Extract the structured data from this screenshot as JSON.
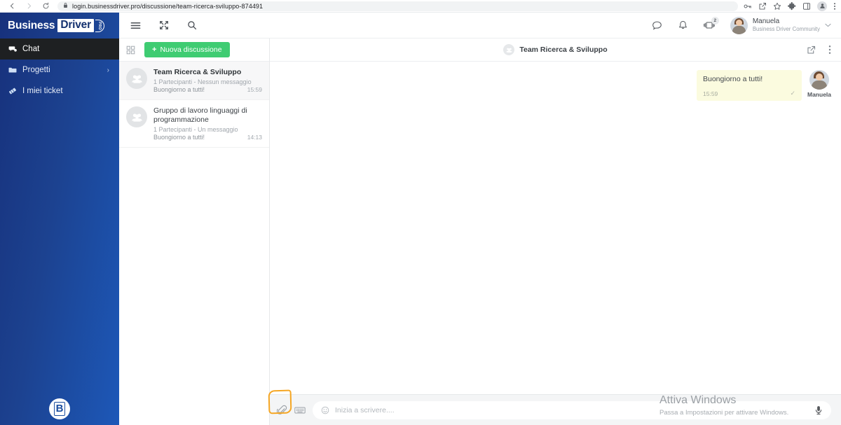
{
  "browser": {
    "back_icon": "back-arrow-icon",
    "forward_icon": "forward-arrow-icon",
    "reload_icon": "reload-icon",
    "lock_icon": "lock-icon",
    "url": "login.businessdriver.pro/discussione/team-ricerca-sviluppo-874491",
    "toolbar_icons": [
      "key-icon",
      "share-icon",
      "star-icon",
      "extensions-puzzle-icon",
      "sidebar-panel-icon",
      "profile-avatar-icon",
      "chrome-menu-icon"
    ]
  },
  "sidebar": {
    "logo": {
      "word1": "Business",
      "word2": "Driver",
      "badge": "PRO"
    },
    "items": [
      {
        "label": "Chat",
        "icon": "chat-bubble-icon",
        "active": true,
        "chevron": ""
      },
      {
        "label": "Progetti",
        "icon": "folder-icon",
        "active": false,
        "chevron": "›"
      },
      {
        "label": "I miei ticket",
        "icon": "ticket-icon",
        "active": false,
        "chevron": ""
      }
    ],
    "brand_mark": "B"
  },
  "topbar": {
    "left_icons": [
      "hamburger-menu-icon",
      "expand-fullscreen-icon",
      "search-icon"
    ],
    "right_icons": [
      "chat-bubble-icon",
      "bell-notification-icon",
      "cards-stack-icon"
    ],
    "cards_badge": "2",
    "user": {
      "name": "Manuela",
      "org": "Business Driver Community",
      "chevron": "∨"
    }
  },
  "list": {
    "grid_icon": "grid-apps-icon",
    "new_button": {
      "plus": "+",
      "label": "Nuova discussione"
    },
    "conversations": [
      {
        "title": "Team Ricerca & Sviluppo",
        "subtitle": "1 Partecipanti - Nessun messaggio",
        "last_message": "Buongiorno a tutti!",
        "time": "15:59",
        "selected": true
      },
      {
        "title": "Gruppo di lavoro linguaggi di programmazione",
        "subtitle": "1 Partecipanti - Un messaggio",
        "last_message": "Buongiorno a tutti!",
        "time": "14:13",
        "selected": false
      }
    ]
  },
  "chat": {
    "header": {
      "title": "Team Ricerca & Sviluppo",
      "avatar_icon": "group-avatar-icon",
      "open_external_icon": "external-link-icon",
      "more_icon": "more-vertical-icon"
    },
    "messages": [
      {
        "text": "Buongiorno a tutti!",
        "time": "15:59",
        "status_check": "✓",
        "author": "Manuela",
        "outgoing": true
      }
    ],
    "composer": {
      "attach_icon": "paperclip-icon",
      "keyboard_icon": "keyboard-icon",
      "smiley_icon": "smiley-icon",
      "placeholder": "Inizia a scrivere....",
      "value": "",
      "mic_icon": "microphone-icon"
    }
  },
  "annotation": {
    "shape": "orange-highlight-rectangle",
    "color": "#f5a623",
    "target": "paperclip-icon"
  },
  "watermark": {
    "title": "Attiva Windows",
    "subtitle": "Passa a Impostazioni per attivare Windows."
  },
  "colors": {
    "sidebar_dark": "#17317c",
    "sidebar_light": "#1d58b8",
    "accent_green": "#3fcc72",
    "bubble_yellow": "#fbfbdf",
    "annotation_orange": "#f5a623"
  }
}
